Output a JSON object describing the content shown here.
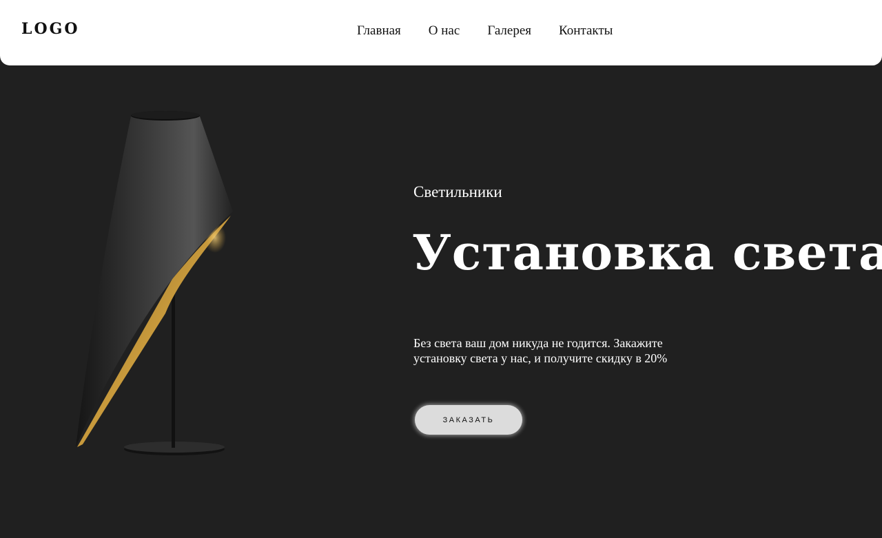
{
  "header": {
    "logo": "LOGO",
    "nav": [
      {
        "label": "Главная"
      },
      {
        "label": "О нас"
      },
      {
        "label": "Галерея"
      },
      {
        "label": "Контакты"
      }
    ]
  },
  "hero": {
    "eyebrow": "Светильники",
    "title": "Установка света",
    "description": "Без света ваш дом никуда не годится. Закажите установку света у нас, и получите скидку в 20%",
    "button_label": "ЗАКАЗАТЬ",
    "image_icon": "table-lamp"
  },
  "colors": {
    "background": "#202020",
    "header_bg": "#ffffff",
    "button_bg": "#dcdcdc",
    "lamp_shade": "#2b2b2b",
    "lamp_inner": "#c89a3c"
  }
}
